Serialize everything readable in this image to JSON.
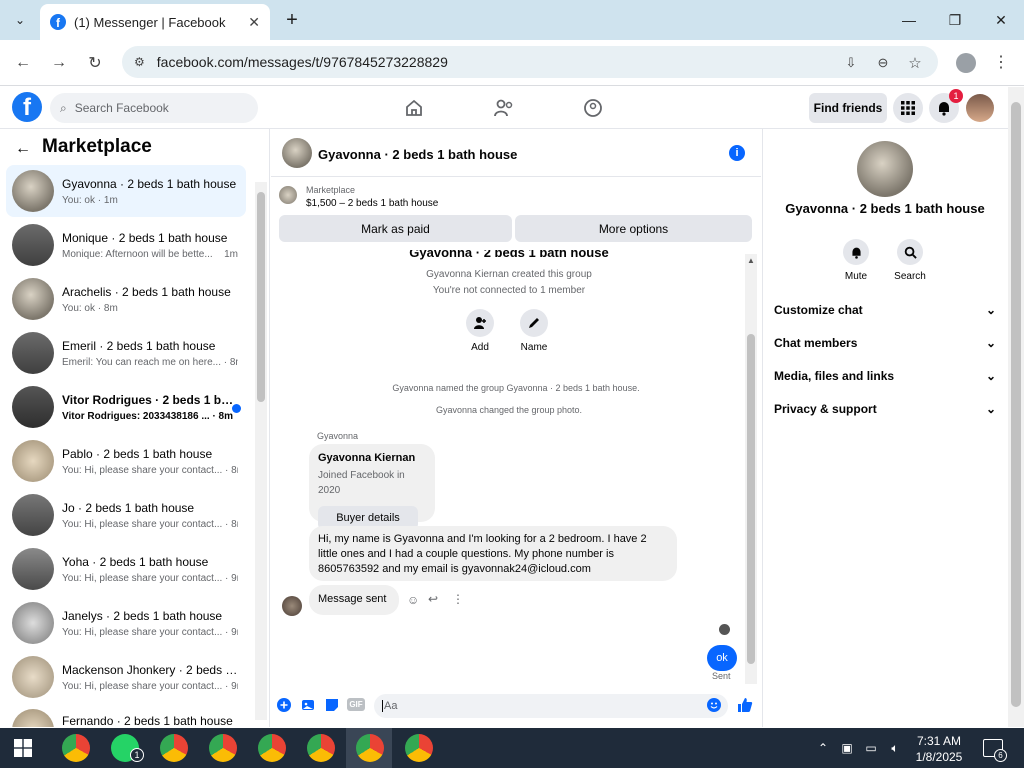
{
  "browser": {
    "tab_title": "(1) Messenger | Facebook",
    "url": "facebook.com/messages/t/9767845273228829"
  },
  "fb": {
    "search_placeholder": "Search Facebook",
    "find_friends": "Find friends",
    "notification_count": "1"
  },
  "sidebar": {
    "title": "Marketplace",
    "conversations": [
      {
        "name": "Gyavonna · 2 beds 1 bath house",
        "preview": "You: ok · 1m"
      },
      {
        "name": "Monique · 2 beds 1 bath house",
        "preview": "Monique: Afternoon will be bette...",
        "time": "1m"
      },
      {
        "name": "Arachelis · 2 beds 1 bath house",
        "preview": "You: ok · 8m"
      },
      {
        "name": "Emeril · 2 beds 1 bath house",
        "preview": "Emeril: You can reach me on here... · 8m"
      },
      {
        "name": "Vitor Rodrigues · 2 beds 1 bat...",
        "preview": "Vitor Rodrigues: 2033438186 ... · 8m"
      },
      {
        "name": "Pablo · 2 beds 1 bath house",
        "preview": "You: Hi, please share your contact... · 8m"
      },
      {
        "name": "Jo · 2 beds 1 bath house",
        "preview": "You: Hi, please share your contact... · 8m"
      },
      {
        "name": "Yoha · 2 beds 1 bath house",
        "preview": "You: Hi, please share your contact... · 9m"
      },
      {
        "name": "Janelys · 2 beds 1 bath house",
        "preview": "You: Hi, please share your contact... · 9m"
      },
      {
        "name": "Mackenson Jhonkery · 2 beds 1...",
        "preview": "You: Hi, please share your contact... · 9m"
      },
      {
        "name": "Fernando · 2 beds 1 bath house",
        "preview": ""
      }
    ]
  },
  "chat": {
    "title": "Gyavonna · 2 beds 1 bath house",
    "marketplace_label": "Marketplace",
    "listing": "$1,500 – 2 beds 1 bath house",
    "mark_paid": "Mark as paid",
    "more_options": "More options",
    "group_title": "Gyavonna · 2 beds 1 bath house",
    "created_by": "Gyavonna Kiernan created this group",
    "not_connected": "You're not connected to 1 member",
    "add_label": "Add",
    "name_label": "Name",
    "named_group": "Gyavonna named the group Gyavonna · 2 beds 1 bath house.",
    "changed_photo": "Gyavonna changed the group photo.",
    "sender_name": "Gyavonna",
    "card_name": "Gyavonna Kiernan",
    "card_joined": "Joined Facebook in 2020",
    "buyer_details": "Buyer details",
    "message_line1": "Hi, my name is Gyavonna and I'm looking for a 2 bedroom. I have 2",
    "message_line2": "little ones and I had a couple questions. My phone number is",
    "message_line3": "8605763592 and my email is gyavonnak24@icloud.com",
    "message_sent": "Message sent",
    "reply_text": "ok",
    "sent_status": "Sent",
    "input_placeholder": "Aa"
  },
  "right_panel": {
    "title": "Gyavonna · 2 beds 1 bath house",
    "mute": "Mute",
    "search": "Search",
    "sections": [
      "Customize chat",
      "Chat members",
      "Media, files and links",
      "Privacy & support"
    ]
  },
  "taskbar": {
    "time": "7:31 AM",
    "date": "1/8/2025",
    "whatsapp_badge": "1",
    "notif_badge": "6"
  },
  "colors": {
    "accent": "#0866ff",
    "fb_blue": "#1877f2",
    "active_row": "#ebf5ff",
    "taskbar": "#1f2b3a"
  }
}
